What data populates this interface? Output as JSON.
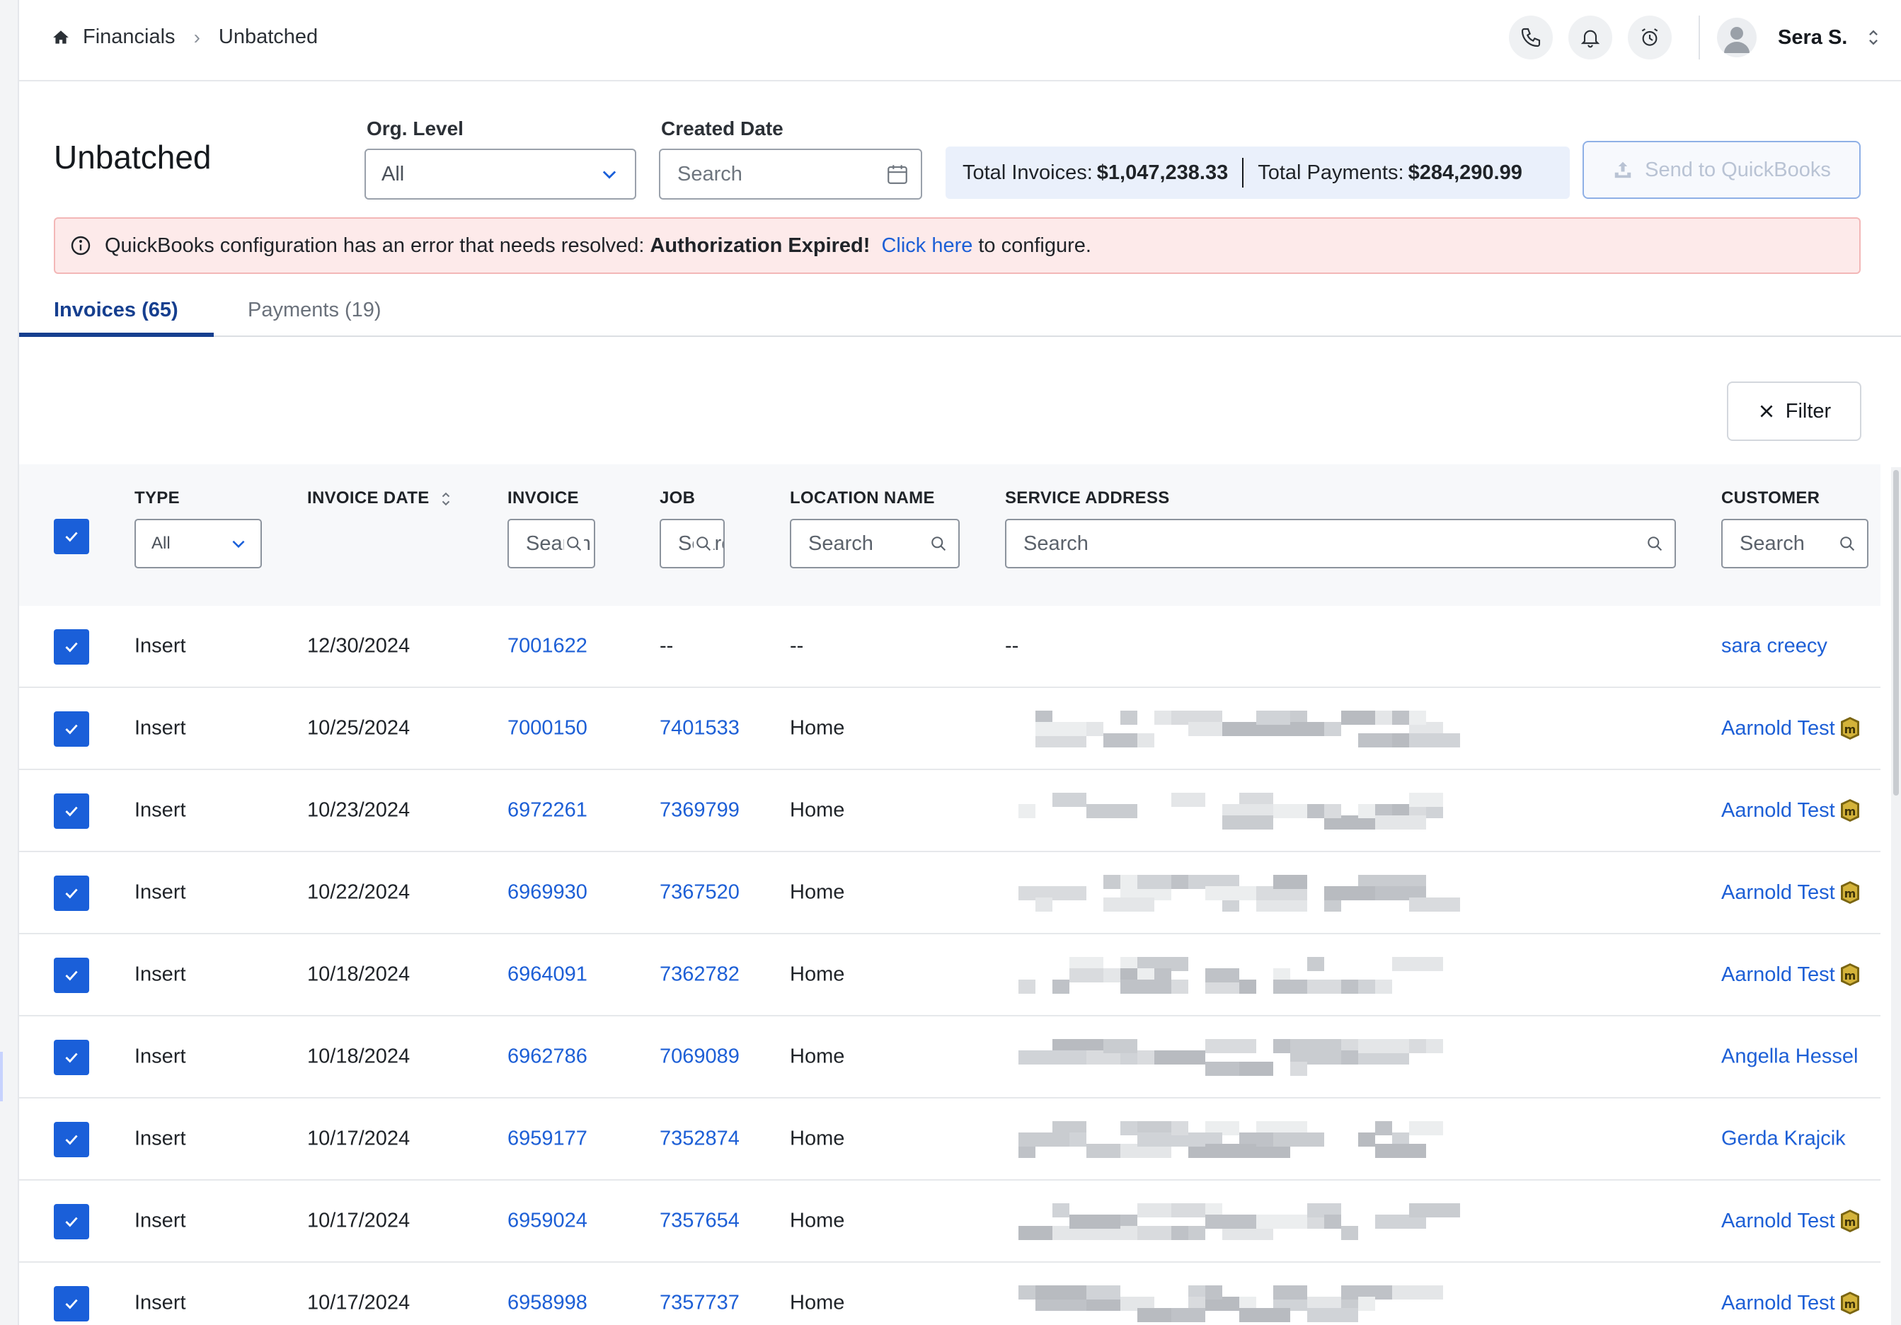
{
  "breadcrumb": {
    "root": "Financials",
    "current": "Unbatched"
  },
  "header": {
    "icons": [
      "phone-icon",
      "bell-icon",
      "alarm-clock-icon"
    ],
    "user_name": "Sera S."
  },
  "page": {
    "title": "Unbatched",
    "org_level_label": "Org. Level",
    "org_level_value": "All",
    "created_date_label": "Created Date",
    "created_date_placeholder": "Search",
    "totals": {
      "invoices_label": "Total Invoices:",
      "invoices_value": "$1,047,238.33",
      "payments_label": "Total Payments:",
      "payments_value": "$284,290.99"
    },
    "send_button": "Send to QuickBooks"
  },
  "alert": {
    "text": "QuickBooks configuration has an error that needs resolved:",
    "bold": "Authorization Expired!",
    "link": "Click here",
    "suffix": "to configure."
  },
  "tabs": [
    {
      "label": "Invoices (65)",
      "active": true
    },
    {
      "label": "Payments (19)",
      "active": false
    }
  ],
  "filter_button": "Filter",
  "table": {
    "headers": {
      "type": "TYPE",
      "invoice_date": "INVOICE DATE",
      "invoice": "INVOICE",
      "job": "JOB",
      "location_name": "LOCATION NAME",
      "service_address": "SERVICE ADDRESS",
      "customer": "CUSTOMER"
    },
    "filters": {
      "type_value": "All",
      "invoice_placeholder": "Search",
      "job_placeholder": "Search",
      "location_placeholder": "Search",
      "address_placeholder": "Search",
      "customer_placeholder": "Search"
    },
    "rows": [
      {
        "type": "Insert",
        "date": "12/30/2024",
        "invoice": "7001622",
        "job": "--",
        "location": "--",
        "address": "--",
        "customer": "sara creecy",
        "badge": false
      },
      {
        "type": "Insert",
        "date": "10/25/2024",
        "invoice": "7000150",
        "job": "7401533",
        "location": "Home",
        "address": "",
        "customer": "Aarnold Test",
        "badge": true
      },
      {
        "type": "Insert",
        "date": "10/23/2024",
        "invoice": "6972261",
        "job": "7369799",
        "location": "Home",
        "address": "",
        "customer": "Aarnold Test",
        "badge": true
      },
      {
        "type": "Insert",
        "date": "10/22/2024",
        "invoice": "6969930",
        "job": "7367520",
        "location": "Home",
        "address": "",
        "customer": "Aarnold Test",
        "badge": true
      },
      {
        "type": "Insert",
        "date": "10/18/2024",
        "invoice": "6964091",
        "job": "7362782",
        "location": "Home",
        "address": "",
        "customer": "Aarnold Test",
        "badge": true
      },
      {
        "type": "Insert",
        "date": "10/18/2024",
        "invoice": "6962786",
        "job": "7069089",
        "location": "Home",
        "address": "",
        "customer": "Angella Hessel",
        "badge": false
      },
      {
        "type": "Insert",
        "date": "10/17/2024",
        "invoice": "6959177",
        "job": "7352874",
        "location": "Home",
        "address": "",
        "customer": "Gerda Krajcik",
        "badge": false
      },
      {
        "type": "Insert",
        "date": "10/17/2024",
        "invoice": "6959024",
        "job": "7357654",
        "location": "Home",
        "address": "",
        "customer": "Aarnold Test",
        "badge": true
      },
      {
        "type": "Insert",
        "date": "10/17/2024",
        "invoice": "6958998",
        "job": "7357737",
        "location": "Home",
        "address": "",
        "customer": "Aarnold Test",
        "badge": true
      }
    ]
  },
  "colors": {
    "primary": "#1a5fd9",
    "link": "#1d5fd6",
    "tab_active": "#163f8f",
    "alert_bg": "#fdeaea",
    "alert_border": "#f3b7b7",
    "totals_bg": "#eaf0fb"
  }
}
